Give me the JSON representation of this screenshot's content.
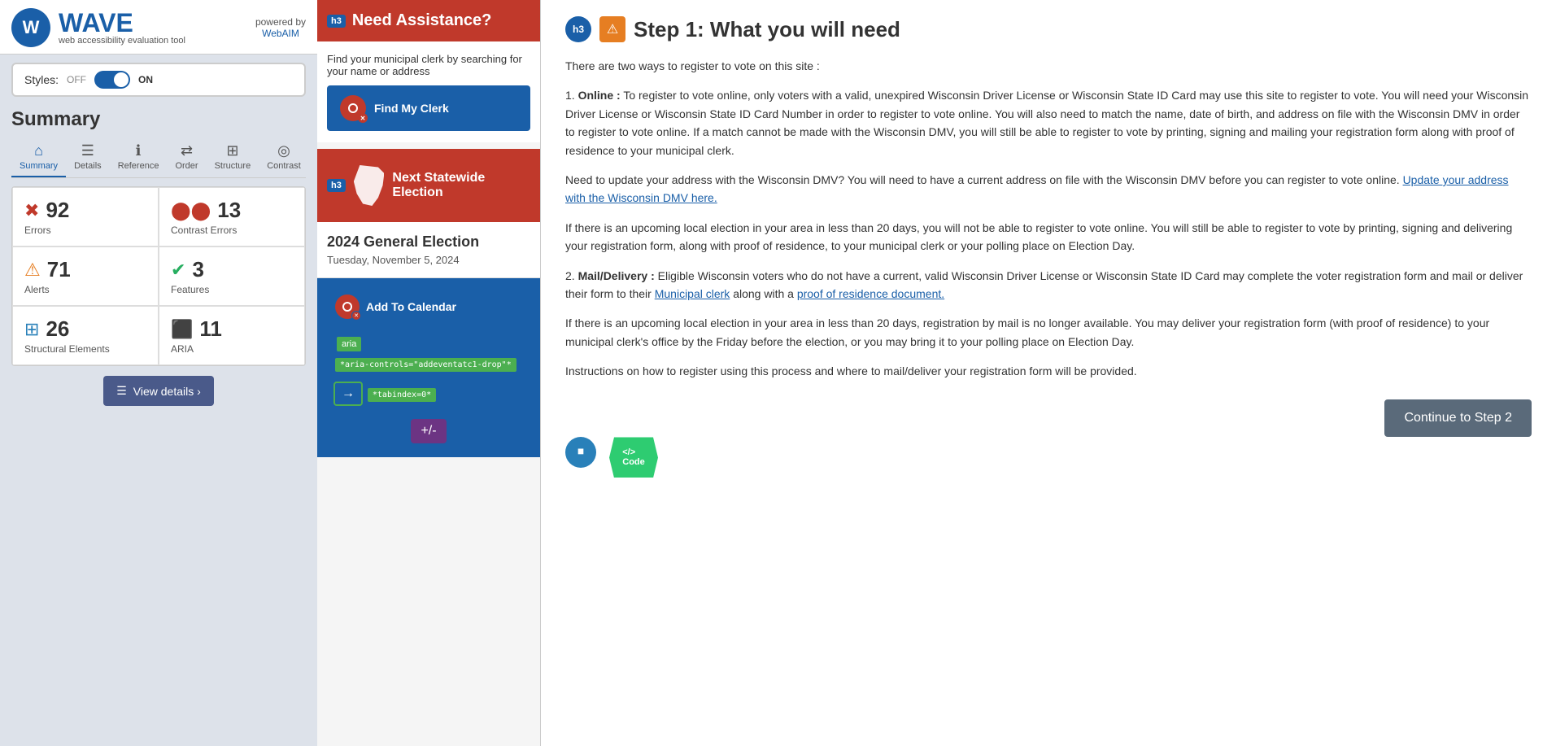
{
  "app": {
    "title": "WAVE",
    "subtitle": "web accessibility evaluation tool",
    "powered_by": "powered by",
    "webAIM_label": "WebAIM"
  },
  "styles_bar": {
    "label": "Styles:",
    "off": "OFF",
    "on": "ON"
  },
  "summary": {
    "title": "Summary",
    "stats": {
      "errors": {
        "count": "92",
        "label": "Errors"
      },
      "contrast_errors": {
        "count": "13",
        "label": "Contrast Errors"
      },
      "alerts": {
        "count": "71",
        "label": "Alerts"
      },
      "features": {
        "count": "3",
        "label": "Features"
      },
      "structural": {
        "count": "26",
        "label": "Structural Elements"
      },
      "aria": {
        "count": "11",
        "label": "ARIA"
      }
    },
    "view_details": "View details ›"
  },
  "nav_tabs": [
    {
      "id": "summary",
      "label": "Summary",
      "icon": "⌂",
      "active": true
    },
    {
      "id": "details",
      "label": "Details",
      "icon": "☰"
    },
    {
      "id": "reference",
      "label": "Reference",
      "icon": "ℹ"
    },
    {
      "id": "order",
      "label": "Order",
      "icon": "⇄"
    },
    {
      "id": "structure",
      "label": "Structure",
      "icon": "⊞"
    },
    {
      "id": "contrast",
      "label": "Contrast",
      "icon": "◎"
    }
  ],
  "middle": {
    "need_assistance": {
      "h3_badge": "h3",
      "title": "Need Assistance?",
      "body": "Find your municipal clerk by searching for your name or address",
      "find_clerk_btn": "Find My Clerk"
    },
    "next_election": {
      "h3_badge": "h3",
      "title": "Next Statewide Election"
    },
    "election": {
      "name": "2024 General Election",
      "date": "Tuesday, November 5, 2024",
      "add_calendar": "Add To Calendar"
    },
    "aria_labels": {
      "aria": "aria",
      "aria_controls": "*aria-controls=\"addeventatc1-drop\"*",
      "tabindex": "*tabindex=0*",
      "plus_minus": "+/-"
    }
  },
  "main_content": {
    "step_title": "Step 1: What you will need",
    "h3_badge": "h3",
    "paragraphs": {
      "intro": "There are two ways to register to vote on this site :",
      "p1_label": "1.",
      "p1_bold": "Online :",
      "p1_text": " To register to vote online, only voters with a valid, unexpired Wisconsin Driver License or Wisconsin State ID Card may use this site to register to vote. You will need your Wisconsin Driver License or Wisconsin State ID Card Number in order to register to vote online. You will also need to match the name, date of birth, and address on file with the Wisconsin DMV in order to register to vote online. If a match cannot be made with the Wisconsin DMV, you will still be able to register to vote by printing, signing and mailing your registration form along with proof of residence to your municipal clerk.",
      "p2_text": "Need to update your address with the Wisconsin DMV? You will need to have a current address on file with the Wisconsin DMV before you can register to vote online.",
      "p2_link": "Update your address with the Wisconsin DMV here.",
      "p3_text": "If there is an upcoming local election in your area in less than 20 days, you will not be able to register to vote online. You will still be able to register to vote by printing, signing and delivering your registration form, along with proof of residence, to your municipal clerk or your polling place on Election Day.",
      "p4_label": "2.",
      "p4_bold": "Mail/Delivery :",
      "p4_text": " Eligible Wisconsin voters who do not have a current, valid Wisconsin Driver License or Wisconsin State ID Card may complete the voter registration form and mail or deliver their form to their",
      "p4_link1": "Municipal clerk",
      "p4_mid": " along with a",
      "p4_link2": "proof of residence document.",
      "p5_text": "If there is an upcoming local election in your area in less than 20 days, registration by mail is no longer available. You may deliver your registration form (with proof of residence) to your municipal clerk's office by the Friday before the election, or you may bring it to your polling place on Election Day.",
      "p6_text": "Instructions on how to register using this process and where to mail/deliver your registration form will be provided."
    },
    "continue_btn": "Continue to Step 2"
  }
}
